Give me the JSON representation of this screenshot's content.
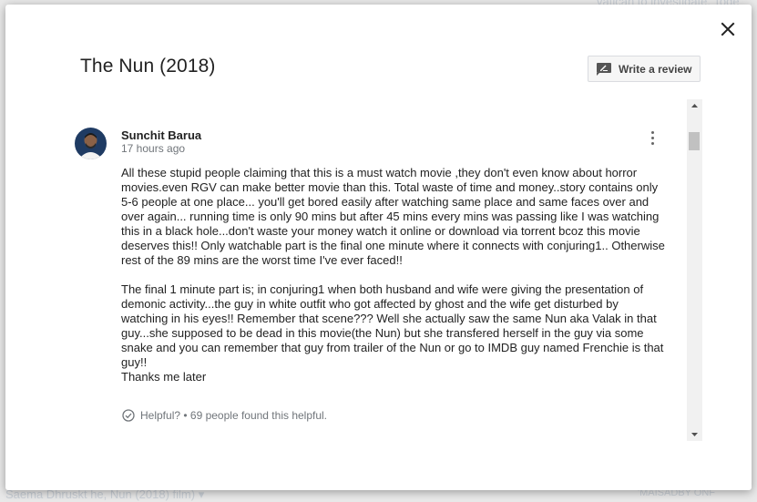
{
  "background": {
    "top_snippet": "vatican to investigate. Toge",
    "bottom_snippet": "Saema Dhruskt he, Nun (2018) film) ▾",
    "bottom_right": "'MAISADBY ONF"
  },
  "dialog": {
    "title": "The Nun (2018)",
    "close_icon": "close-icon",
    "write_review_label": "Write a review",
    "write_review_icon": "rate-review-icon"
  },
  "review": {
    "author": "Sunchit Barua",
    "time": "17 hours ago",
    "paragraphs": [
      "All these stupid people claiming that this is a must watch movie ,they don't even know about horror movies.even RGV can make better movie than this. Total waste of time and money..story contains only 5-6 people at one place... you'll get bored easily after watching same place and same faces over and over again... running time is only 90 mins but after 45 mins every mins was passing like I was watching this in a black hole...don't waste your money watch it online or download via torrent bcoz this movie deserves this!! Only watchable part is the final one minute where it connects with conjuring1.. Otherwise rest of the 89 mins are the worst time I've ever faced!!",
      "The final 1 minute part is; in conjuring1 when both husband and wife were giving the presentation of demonic activity...the guy in white outfit who got affected by ghost and the wife get disturbed by watching in his eyes!! Remember that scene??? Well she actually saw the same Nun aka Valak in that guy...she supposed to be dead in this movie(the Nun) but she transfered herself in the guy via some snake and you can remember that guy from trailer of the Nun or go to IMDB guy named Frenchie is that guy!!\nThanks me later"
    ],
    "helpful_text": "Helpful? • 69 people found this helpful.",
    "helpful_icon": "check-circle-icon",
    "more_icon": "more-vert-icon"
  },
  "colors": {
    "accent_text": "#222222",
    "secondary_text": "#70757a",
    "button_bg": "#f6f6f6"
  }
}
